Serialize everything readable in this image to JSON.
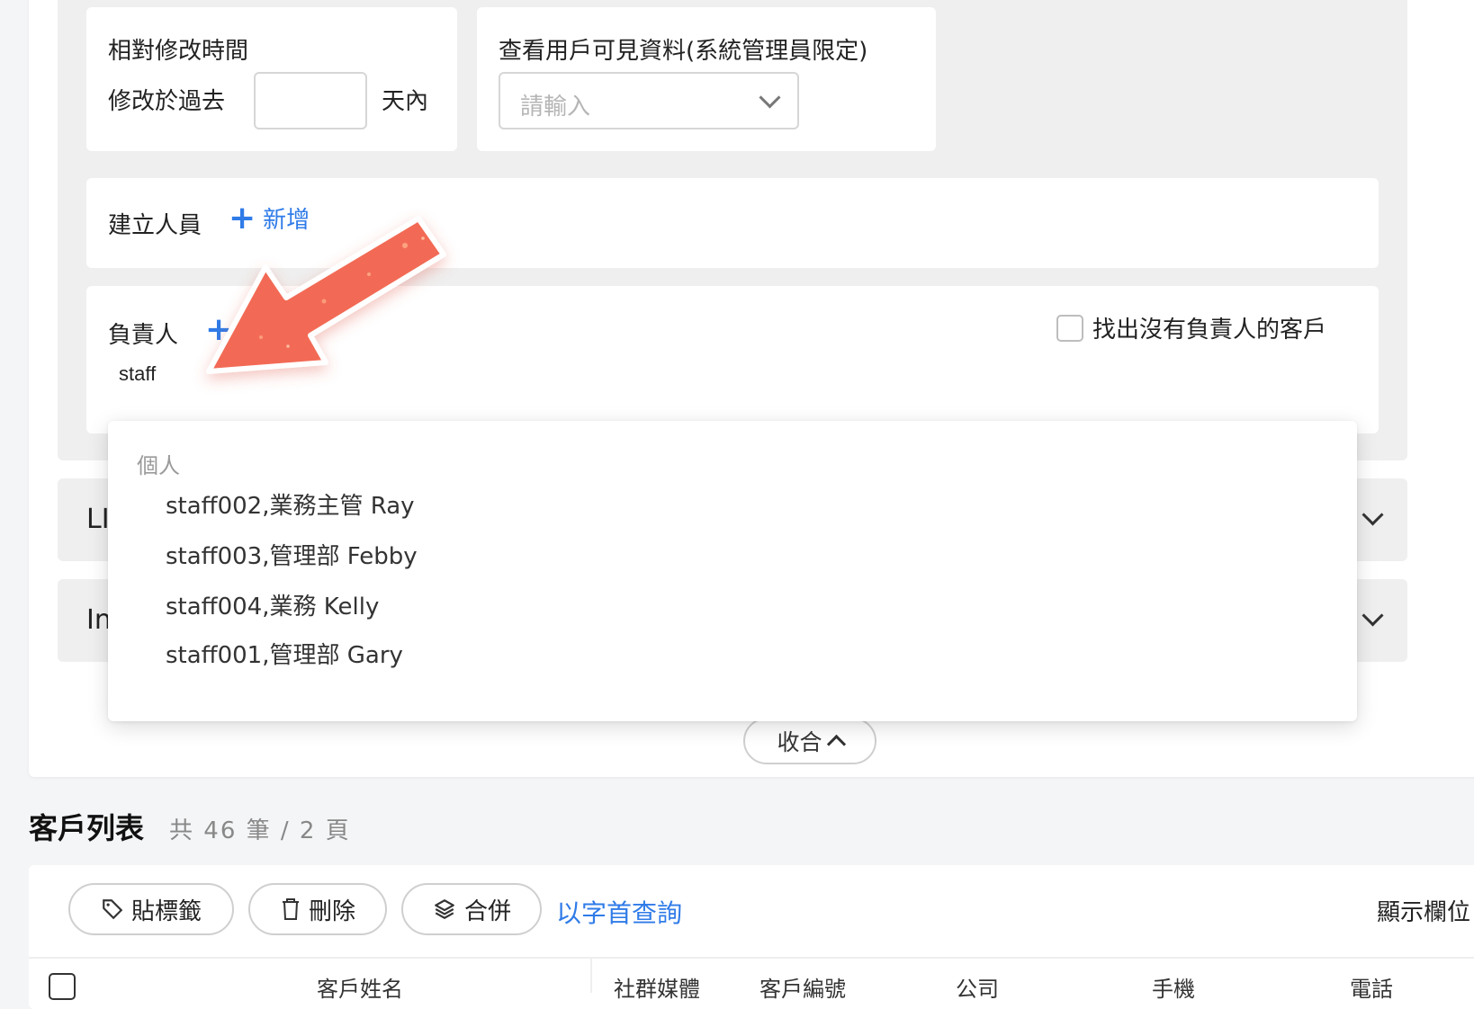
{
  "filters": {
    "relative_time": {
      "title": "相對修改時間",
      "prefix": "修改於過去",
      "value": "",
      "suffix": "天內"
    },
    "visible_data": {
      "title": "查看用戶可見資料(系統管理員限定)",
      "placeholder": "請輸入"
    },
    "creator": {
      "label": "建立人員",
      "add_label": "新增"
    },
    "owner": {
      "label": "負責人",
      "search_value": "staff",
      "no_owner_label": "找出沒有負責人的客戶"
    }
  },
  "collapsed_rows": [
    {
      "label": "LI"
    },
    {
      "label": "In"
    }
  ],
  "dropdown": {
    "group_label": "個人",
    "items": [
      "staff002,業務主管 Ray",
      "staff003,管理部 Febby",
      "staff004,業務 Kelly",
      "staff001,管理部 Gary"
    ]
  },
  "collapse_button": "收合",
  "customer_list": {
    "title": "客戶列表",
    "summary": "共 46 筆 / 2 頁"
  },
  "toolbar": {
    "tag_label": "貼標籤",
    "delete_label": "刪除",
    "merge_label": "合併",
    "initial_search_label": "以字首查詢",
    "columns_label": "顯示欄位"
  },
  "table_headers": [
    "客戶姓名",
    "社群媒體",
    "客戶編號",
    "公司",
    "手機",
    "電話"
  ],
  "colors": {
    "accent": "#2f7be8",
    "arrow": "#f26a55"
  },
  "icons": [
    "plus-icon",
    "chevron-down-icon",
    "chevron-up-icon",
    "tag-icon",
    "trash-icon",
    "layers-icon",
    "arrow-annotation"
  ]
}
